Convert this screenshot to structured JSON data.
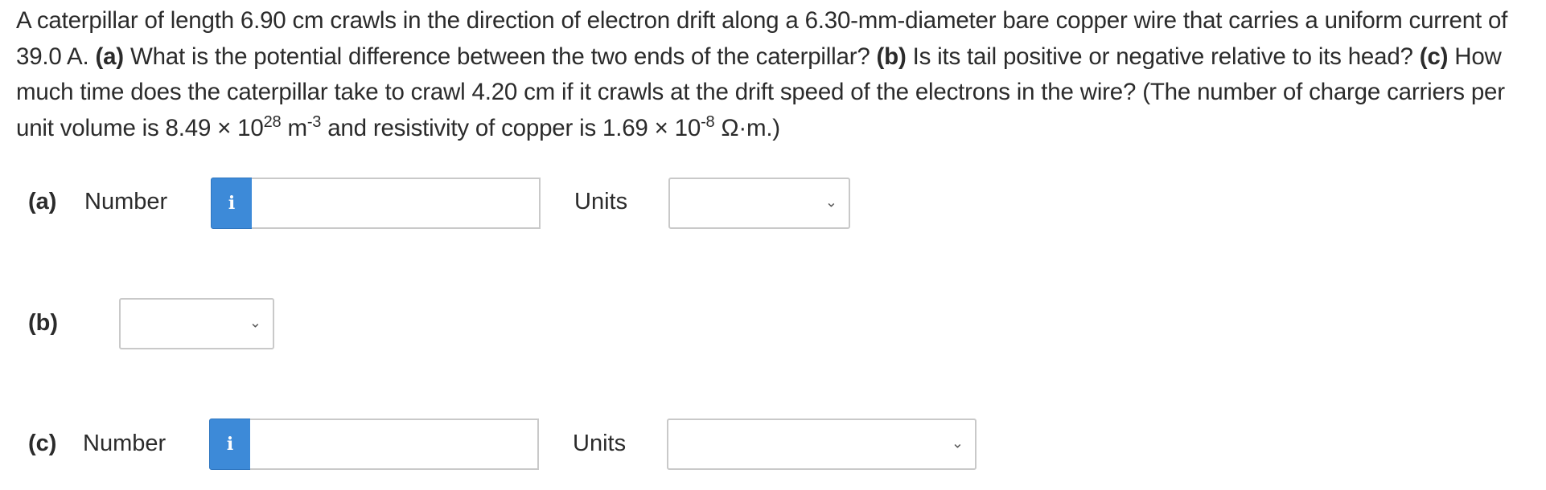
{
  "problem": {
    "intro": "A caterpillar of length 6.90 cm crawls in the direction of electron drift along a 6.30-mm-diameter bare copper wire that carries a uniform current of 39.0 A.",
    "a_label": "(a)",
    "a_text": "What is the potential difference between the two ends of the caterpillar?",
    "b_label": "(b)",
    "b_text": "Is its tail positive or negative relative to its head?",
    "c_label": "(c)",
    "c_text": "How much time does the caterpillar take to crawl 4.20 cm if it crawls at the drift speed of the electrons in the wire?",
    "note_1": "(The number of charge carriers per unit volume is 8.49 × 10",
    "note_exp1": "28",
    "note_2": " m",
    "note_exp2": "-3",
    "note_3": " and resistivity of copper is 1.69 × 10",
    "note_exp3": "-8",
    "note_4": " Ω·m.)"
  },
  "part_a": {
    "label": "(a)",
    "number_label": "Number",
    "info_icon": "i",
    "number_value": "",
    "units_label": "Units",
    "units_selected": ""
  },
  "part_b": {
    "label": "(b)",
    "selected": ""
  },
  "part_c": {
    "label": "(c)",
    "number_label": "Number",
    "info_icon": "i",
    "number_value": "",
    "units_label": "Units",
    "units_selected": ""
  },
  "icons": {
    "chevron": "chevron-down-icon",
    "info": "info-icon"
  },
  "colors": {
    "info_button": "#3d8ad8",
    "text": "#2b2b2b",
    "border": "#c9c9c9"
  }
}
